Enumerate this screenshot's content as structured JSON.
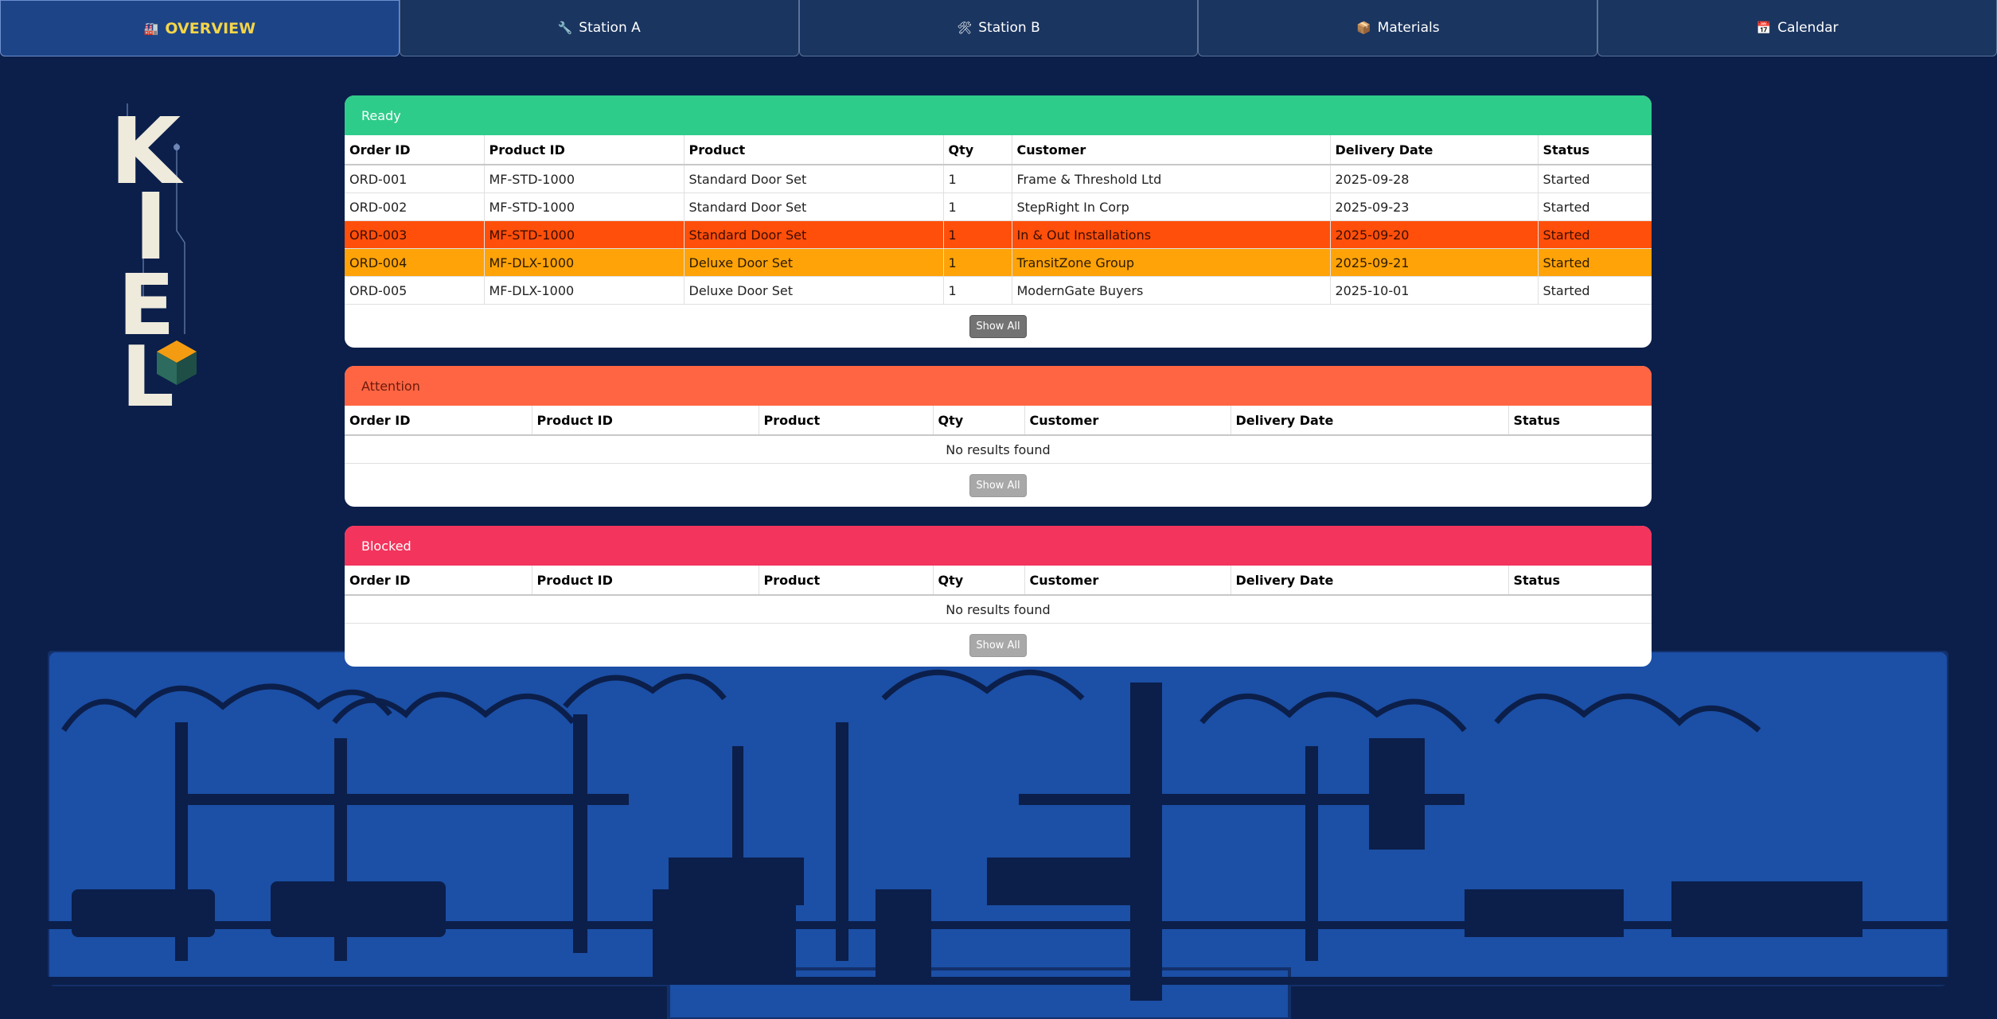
{
  "tabs": [
    {
      "icon": "🏭",
      "label": "OVERVIEW"
    },
    {
      "icon": "🔧",
      "label": "Station A"
    },
    {
      "icon": "🛠",
      "label": "Station B"
    },
    {
      "icon": "📦",
      "label": "Materials"
    },
    {
      "icon": "📅",
      "label": "Calendar"
    }
  ],
  "logo": {
    "text": "KIEL",
    "letters": [
      "K",
      "I",
      "E",
      "L"
    ]
  },
  "columns": [
    "Order ID",
    "Product ID",
    "Product",
    "Qty",
    "Customer",
    "Delivery Date",
    "Status"
  ],
  "ready": {
    "title": "Ready",
    "rows": [
      [
        "ORD-001",
        "MF-STD-1000",
        "Standard Door Set",
        "1",
        "Frame & Threshold Ltd",
        "2025-09-28",
        "Started"
      ],
      [
        "ORD-002",
        "MF-STD-1000",
        "Standard Door Set",
        "1",
        "StepRight In Corp",
        "2025-09-23",
        "Started"
      ],
      [
        "ORD-003",
        "MF-STD-1000",
        "Standard Door Set",
        "1",
        "In & Out Installations",
        "2025-09-20",
        "Started"
      ],
      [
        "ORD-004",
        "MF-DLX-1000",
        "Deluxe Door Set",
        "1",
        "TransitZone Group",
        "2025-09-21",
        "Started"
      ],
      [
        "ORD-005",
        "MF-DLX-1000",
        "Deluxe Door Set",
        "1",
        "ModernGate Buyers",
        "2025-10-01",
        "Started"
      ]
    ],
    "row_highlights": [
      "none",
      "none",
      "red",
      "orange",
      "none"
    ],
    "show_all": "Show All"
  },
  "attention": {
    "title": "Attention",
    "empty": "No results found",
    "show_all": "Show All"
  },
  "blocked": {
    "title": "Blocked",
    "empty": "No results found",
    "show_all": "Show All"
  },
  "colors": {
    "background": "#0b1f4a",
    "ready": "#2ecc8a",
    "attention": "#ff6543",
    "blocked": "#f3345c",
    "row_red": "#ff4f0a",
    "row_orange": "#ffa308",
    "skyline": "#1c4fa6"
  }
}
